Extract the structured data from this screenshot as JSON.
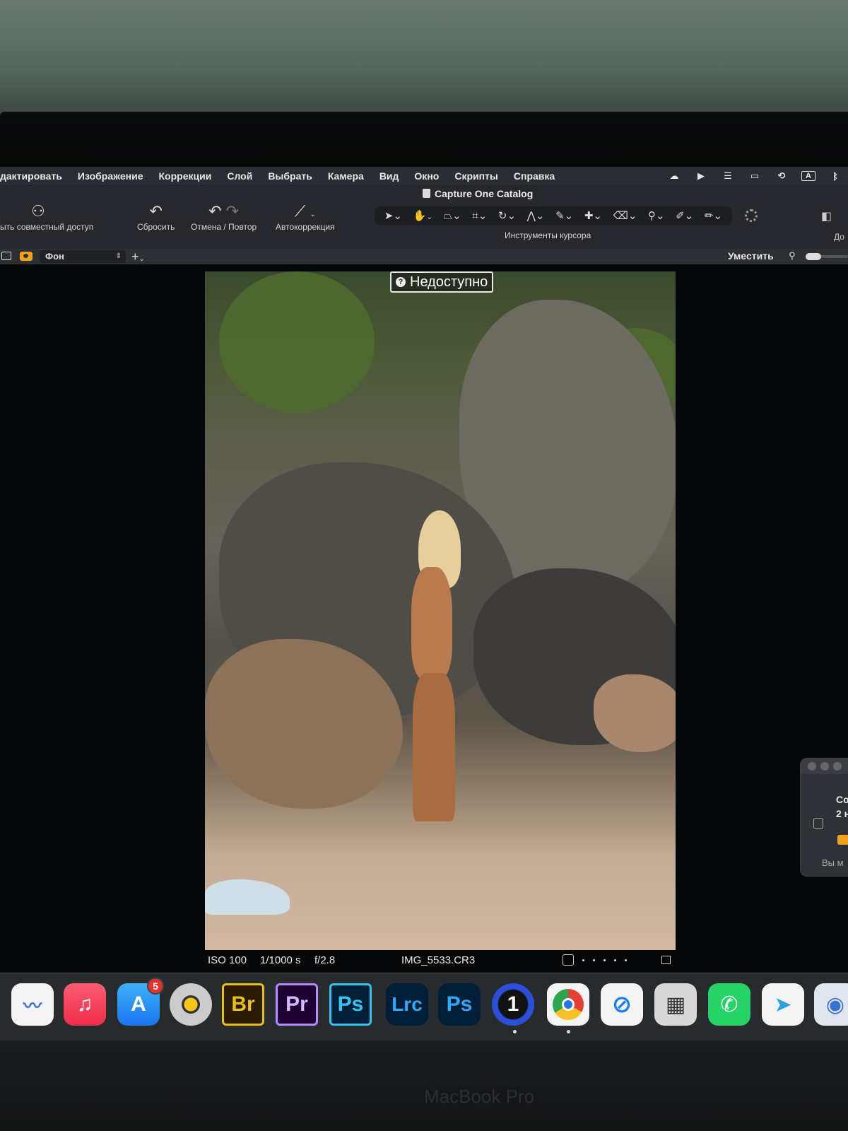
{
  "menu": {
    "items": [
      "дактировать",
      "Изображение",
      "Коррекции",
      "Слой",
      "Выбрать",
      "Камера",
      "Вид",
      "Окно",
      "Скрипты",
      "Справка"
    ]
  },
  "window": {
    "title": "Capture One Catalog"
  },
  "toolbar": {
    "share_label": "ыть совместный доступ",
    "reset_label": "Сбросить",
    "undo_redo_label": "Отмена / Повтор",
    "autocorrect_label": "Автокоррекция",
    "cursor_tools_label": "Инструменты курсора",
    "right_label": "До"
  },
  "layers": {
    "selected_layer": "Фон",
    "fit_label": "Уместить"
  },
  "viewer": {
    "status_overlay": "Недоступно"
  },
  "info": {
    "iso": "ISO 100",
    "shutter": "1/1000 s",
    "aperture": "f/2.8",
    "filename": "IMG_5533.CR3"
  },
  "notification": {
    "line1": "Co",
    "line2": "2 н",
    "line3": "Вы м"
  },
  "dock": {
    "appstore_badge": "5",
    "apps": {
      "br": "Br",
      "pr": "Pr",
      "ps1": "Ps",
      "lrc": "Lrc",
      "ps2": "Ps",
      "one": "1"
    }
  },
  "device": {
    "brand": "MacBook Pro"
  },
  "colors": {
    "accent": "#f29b1d",
    "menubar": "#2a2d33",
    "toolbar": "#26282d"
  }
}
